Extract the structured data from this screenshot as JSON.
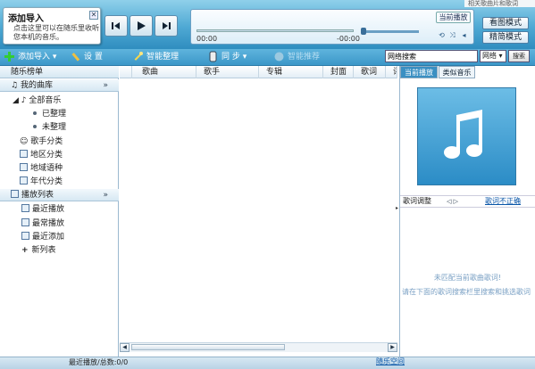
{
  "top_note": "相关歌曲片和歌词",
  "tip": {
    "title": "添加导入",
    "body": "点击这里可以在随乐里收听您本机的音乐。",
    "close": "✕"
  },
  "player": {
    "now_playing": "当前播放",
    "time_start": "00:00",
    "time_end": "-00:00",
    "view_mode": "看图模式",
    "compact_mode": "精简模式"
  },
  "toolbar": {
    "add_import": "添加导入",
    "settings": "设 置",
    "smart_organize": "智能整理",
    "sync": "同 步",
    "smart_recommend": "智能推荐"
  },
  "search": {
    "value": "网络搜索",
    "scope": "网络",
    "button": "搜索"
  },
  "sidebar": {
    "header": "随乐榜单",
    "library": "我的曲库",
    "collapse": "»",
    "all_music": "全部音乐",
    "organized": "已整理",
    "unorganized": "未整理",
    "by_singer": "歌手分类",
    "by_region": "地区分类",
    "by_language": "地域语种",
    "by_era": "年代分类",
    "playlists": "播放列表",
    "recent_play": "最近播放",
    "frequent_play": "最常播放",
    "recent_added": "最近添加",
    "new_list": "新列表"
  },
  "columns": [
    "歌曲",
    "歌手",
    "专辑",
    "封面",
    "歌词",
    "评"
  ],
  "right": {
    "tab_current": "当前播放",
    "tab_similar": "类似音乐",
    "lyric_adjust": "歌词调整",
    "lyric_arrows": "◁ ▷",
    "lyric_wrong": "歌词不正确",
    "no_lyric": "未匹配当前歌曲歌词!",
    "no_lyric_hint": "请在下面的歌词搜索栏里搜索和挑选歌词"
  },
  "status": {
    "text": "最近播放/总数:0/0",
    "link": "随乐空间"
  }
}
